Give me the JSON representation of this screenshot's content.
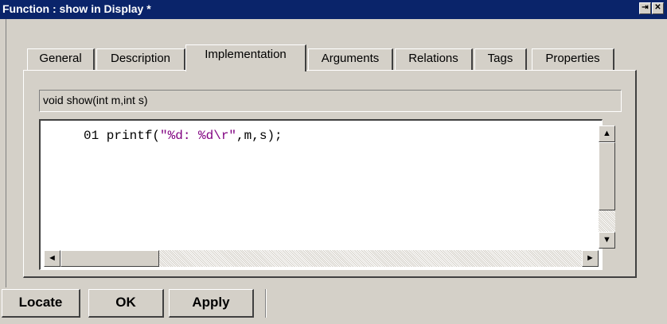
{
  "window": {
    "title": "Function : show in Display *",
    "pin_glyph": "⇥",
    "close_glyph": "✕"
  },
  "tabs": [
    {
      "label": "General"
    },
    {
      "label": "Description"
    },
    {
      "label": "Implementation",
      "active": true
    },
    {
      "label": "Arguments"
    },
    {
      "label": "Relations"
    },
    {
      "label": "Tags"
    },
    {
      "label": "Properties"
    }
  ],
  "signature": "void show(int m,int s)",
  "code": {
    "line_number": "01",
    "prefix": " printf(",
    "string": "\"%d: %d\\r\"",
    "suffix": ",m,s);"
  },
  "scroll_glyphs": {
    "up": "▲",
    "down": "▼",
    "left": "◄",
    "right": "►"
  },
  "buttons": {
    "locate": "Locate",
    "ok": "OK",
    "apply": "Apply"
  },
  "colors": {
    "titlebar": "#0a246a",
    "face": "#d4d0c8",
    "string_literal": "#800080"
  }
}
